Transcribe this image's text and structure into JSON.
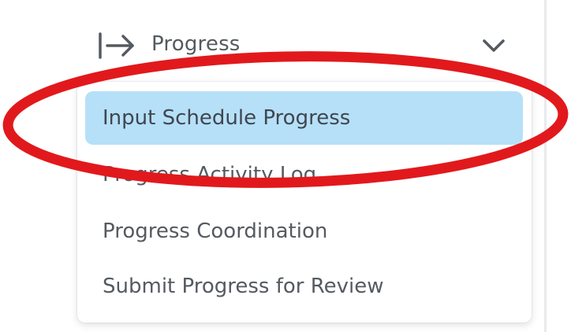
{
  "nav": {
    "section": {
      "label": "Progress",
      "icon": "arrow-to-right-icon",
      "toggle_icon": "chevron-down-icon",
      "expanded": true
    },
    "menu": {
      "items": [
        {
          "label": "Input Schedule Progress",
          "selected": true
        },
        {
          "label": "Progress Activity Log",
          "selected": false
        },
        {
          "label": "Progress Coordination",
          "selected": false
        },
        {
          "label": "Submit Progress for Review",
          "selected": false
        }
      ]
    }
  },
  "colors": {
    "text": "#555a60",
    "selected_bg": "#b6e0f8",
    "annotation_stroke": "#e1191c"
  }
}
